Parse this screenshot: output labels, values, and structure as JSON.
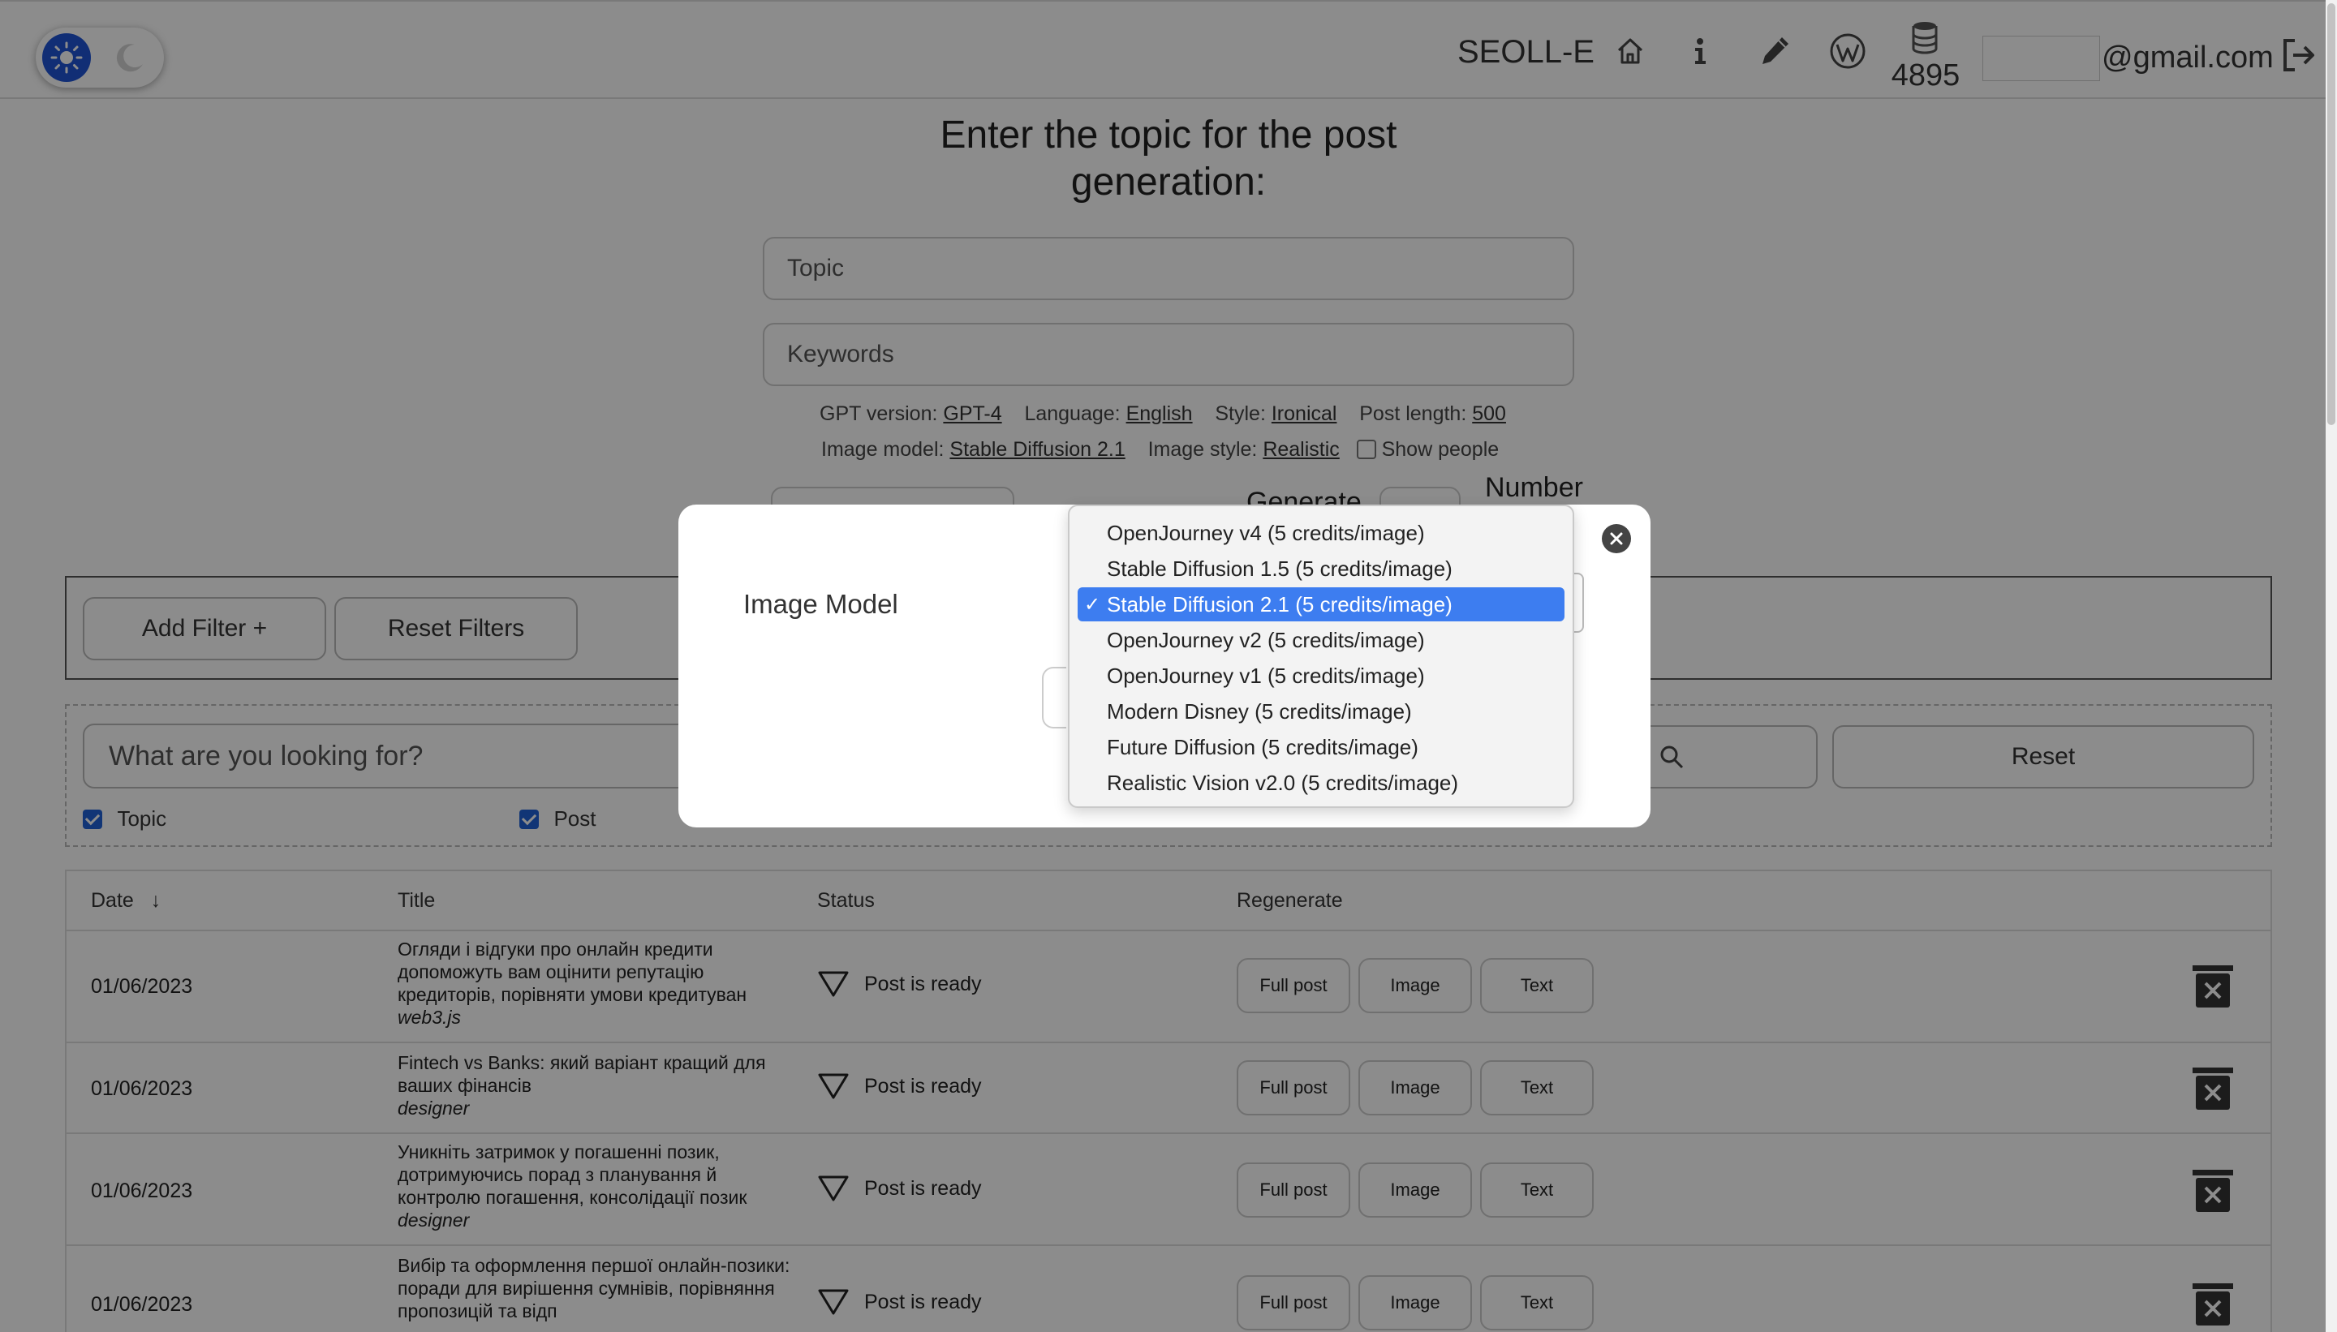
{
  "header": {
    "brand": "SEOLL-E",
    "credits": "4895",
    "email_suffix": "@gmail.com",
    "icons": [
      "sun-icon",
      "moon-icon",
      "home-icon",
      "info-icon",
      "pen-icon",
      "wordpress-icon",
      "database-icon",
      "logout-icon"
    ]
  },
  "main": {
    "heading": "Enter the topic for the post generation:",
    "topic_placeholder": "Topic",
    "keywords_placeholder": "Keywords",
    "settings": {
      "gpt_label": "GPT version:",
      "gpt_value": "GPT-4",
      "language_label": "Language:",
      "language_value": "English",
      "style_label": "Style:",
      "style_value": "Ironical",
      "length_label": "Post length:",
      "length_value": "500",
      "image_model_label": "Image model:",
      "image_model_value": "Stable Diffusion 2.1",
      "image_style_label": "Image style:",
      "image_style_value": "Realistic",
      "show_people_label": "Show people"
    },
    "generate_label": "Generate",
    "number_label": "Number"
  },
  "filters": {
    "add_filter": "Add Filter +",
    "reset_filters": "Reset Filters"
  },
  "search": {
    "placeholder": "What are you looking for?",
    "reset": "Reset",
    "checks": [
      "Topic",
      "Post"
    ]
  },
  "table": {
    "headers": [
      "Date",
      "Title",
      "Status",
      "Regenerate"
    ],
    "regen_buttons": [
      "Full post",
      "Image",
      "Text"
    ],
    "rows": [
      {
        "date": "01/06/2023",
        "title": "Огляди і відгуки про онлайн кредити допоможуть вам оцінити репутацію кредиторів, порівняти умови кредитуван",
        "tag": "web3.js",
        "status": "Post is ready"
      },
      {
        "date": "01/06/2023",
        "title": "Fintech vs Banks: який варіант кращий для ваших фінансів",
        "tag": "designer",
        "status": "Post is ready"
      },
      {
        "date": "01/06/2023",
        "title": "Уникніть затримок у погашенні позик, дотримуючись порад з планування й контролю погашення, консолідації позик",
        "tag": "designer",
        "status": "Post is ready"
      },
      {
        "date": "01/06/2023",
        "title": "Вибір та оформлення першої онлайн-позики: поради для вирішення сумнівів, порівняння пропозицій та відп",
        "tag": "",
        "status": "Post is ready"
      }
    ]
  },
  "modal": {
    "label": "Image Model",
    "options": [
      "OpenJourney v4 (5 credits/image)",
      "Stable Diffusion 1.5 (5 credits/image)",
      "Stable Diffusion 2.1 (5 credits/image)",
      "OpenJourney v2 (5 credits/image)",
      "OpenJourney v1 (5 credits/image)",
      "Modern Disney (5 credits/image)",
      "Future Diffusion (5 credits/image)",
      "Realistic Vision v2.0 (5 credits/image)"
    ],
    "selected": "Stable Diffusion 2.1 (5 credits/image)",
    "selected_color": "#3d7df0"
  }
}
